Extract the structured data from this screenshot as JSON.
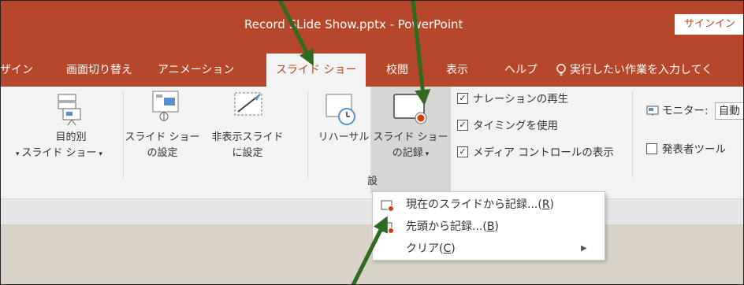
{
  "window": {
    "title": "Record SLide Show.pptx  -  PowerPoint",
    "signin_label": "サインイン"
  },
  "tabs": [
    {
      "label": "ザイン"
    },
    {
      "label": "画面切り替え"
    },
    {
      "label": "アニメーション"
    },
    {
      "label": "スライド ショー",
      "active": true
    },
    {
      "label": "校閲"
    },
    {
      "label": "表示"
    },
    {
      "label": "ヘルプ"
    }
  ],
  "tell_me": "実行したい作業を入力してく",
  "ribbon": {
    "custom_show": {
      "line1": "目的別",
      "line2": "スライド ショー"
    },
    "setup": {
      "line1": "スライド ショー",
      "line2": "の設定"
    },
    "hide": {
      "line1": "非表示スライド",
      "line2": "に設定"
    },
    "rehearse": {
      "line1": "リハーサル"
    },
    "record": {
      "line1": "スライド ショー",
      "line2": "の記録"
    },
    "checks": [
      {
        "label": "ナレーションの再生",
        "checked": true
      },
      {
        "label": "タイミングを使用",
        "checked": true
      },
      {
        "label": "メディア コントロールの表示",
        "checked": true
      }
    ],
    "monitor_label": "モニター:",
    "monitor_value": "自動",
    "presenter_label": "発表者ツール",
    "group_label_fragment": "設"
  },
  "dropdown": {
    "items": [
      {
        "label": "現在のスライドから記録...(",
        "key": "R",
        "suffix": ")"
      },
      {
        "label": "先頭から記録...(",
        "key": "B",
        "suffix": ")"
      },
      {
        "label": "クリア(",
        "key": "C",
        "suffix": ")"
      }
    ]
  },
  "colors": {
    "accent": "#b7472a",
    "annotation_arrow": "#2e6b1f",
    "annotation_fill": "#7ab84a"
  }
}
